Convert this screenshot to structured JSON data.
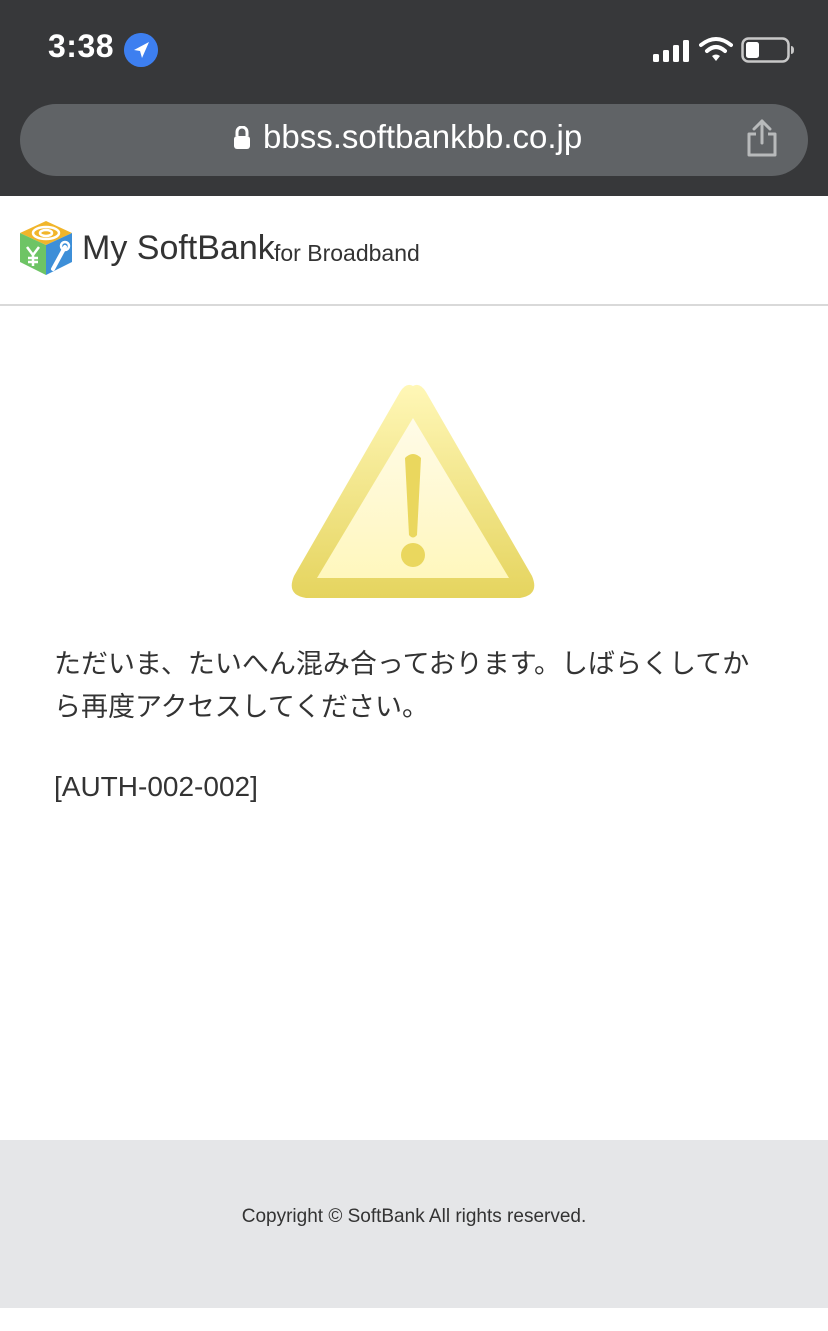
{
  "status_bar": {
    "time": "3:38",
    "icons": [
      "location-arrow-icon",
      "cellular-signal-icon",
      "wifi-icon",
      "battery-icon"
    ]
  },
  "browser": {
    "url": "bbss.softbankbb.co.jp",
    "icons": [
      "lock-icon",
      "share-icon"
    ]
  },
  "header": {
    "logo_text": "My SoftBank",
    "logo_subtext": "for Broadband"
  },
  "main": {
    "icon": "warning-icon",
    "message": "ただいま、たいへん混み合っております。しばらくしてから再度アクセスしてください。",
    "error_code": "[AUTH-002-002]"
  },
  "footer": {
    "copyright": "Copyright © SoftBank All rights reserved."
  },
  "colors": {
    "chrome_background": "#37383a",
    "url_bar": "#606366",
    "location_blue": "#3d7ff0",
    "warning_yellow": "#f0dc62",
    "footer_background": "#e5e6e8",
    "text": "#333333"
  }
}
